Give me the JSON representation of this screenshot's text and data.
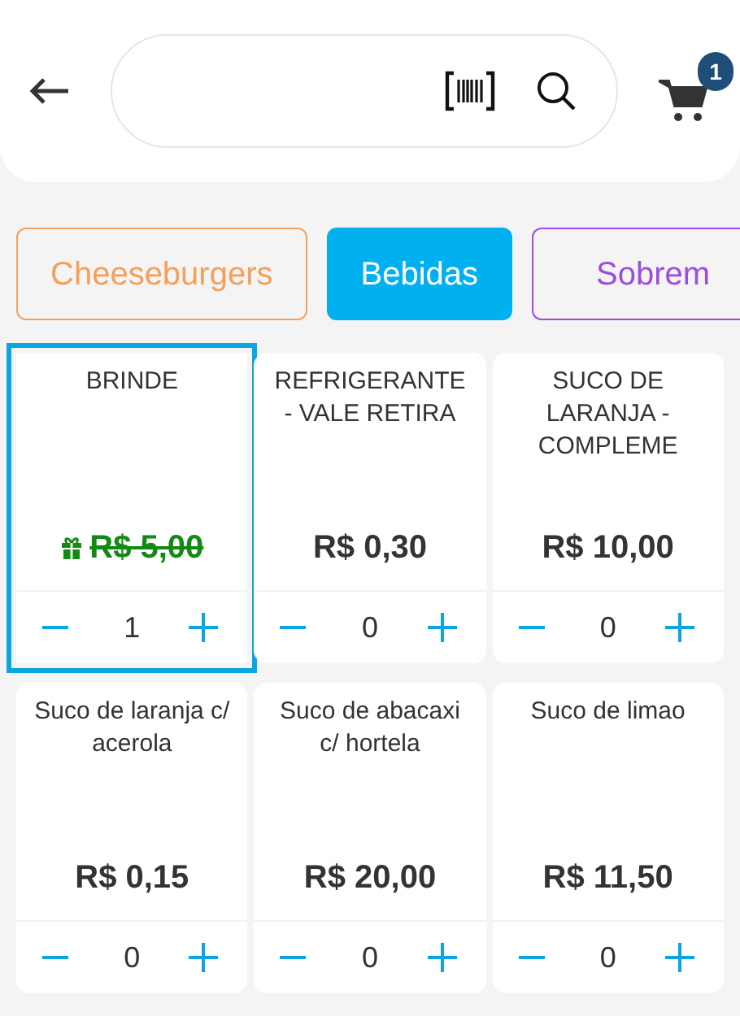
{
  "header": {
    "cart_count": "1"
  },
  "categories": [
    {
      "label": "Cheeseburgers",
      "color": "#f5a05a",
      "selected": false
    },
    {
      "label": "Bebidas",
      "color": "#00b0ef",
      "selected": true
    },
    {
      "label": "Sobrem",
      "color": "#9b4de0",
      "selected": false
    }
  ],
  "products": [
    {
      "name": "BRINDE",
      "price": "R$ 5,00",
      "gift": true,
      "quantity": "1",
      "selected": true
    },
    {
      "name": "REFRIGERANTE - VALE RETIRA",
      "price": "R$ 0,30",
      "gift": false,
      "quantity": "0",
      "selected": false
    },
    {
      "name": "SUCO DE LARANJA - COMPLEME",
      "price": "R$ 10,00",
      "gift": false,
      "quantity": "0",
      "selected": false
    },
    {
      "name": "Suco de laranja c/ acerola",
      "price": "R$ 0,15",
      "gift": false,
      "quantity": "0",
      "selected": false
    },
    {
      "name": "Suco de abacaxi c/ hortela",
      "price": "R$ 20,00",
      "gift": false,
      "quantity": "0",
      "selected": false
    },
    {
      "name": "Suco de limao",
      "price": "R$ 11,50",
      "gift": false,
      "quantity": "0",
      "selected": false
    }
  ]
}
